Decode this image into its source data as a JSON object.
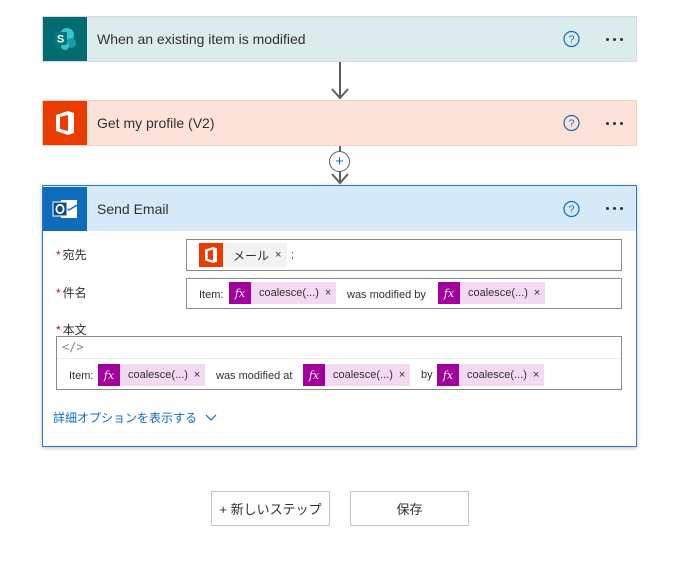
{
  "trigger": {
    "title": "When an existing item is modified",
    "icon": "sharepoint-icon",
    "color": "#036c70"
  },
  "profile": {
    "title": "Get my profile (V2)",
    "icon": "office-icon",
    "color": "#eb3c00"
  },
  "email": {
    "title": "Send Email",
    "icon": "outlook-icon",
    "color": "#0f6cbd",
    "to": {
      "label": "宛先",
      "token": "メール",
      "remove": "×",
      "separator": ";"
    },
    "subject": {
      "label": "件名",
      "prefix": "Item:",
      "token1": "coalesce(...)",
      "middle": "was modified by",
      "token2": "coalesce(...)",
      "remove": "×"
    },
    "body": {
      "label": "本文",
      "code_toggle": "</>",
      "prefix": "Item:",
      "token1": "coalesce(...)",
      "middle1": "was modified at",
      "token2": "coalesce(...)",
      "middle2": "by",
      "token3": "coalesce(...)",
      "remove": "×"
    },
    "advanced": "詳細オプションを表示する"
  },
  "fx_label": "fx",
  "help_label": "?",
  "add_step_symbol": "+",
  "buttons": {
    "new_step": "+ 新しいステップ",
    "save": "保存"
  }
}
